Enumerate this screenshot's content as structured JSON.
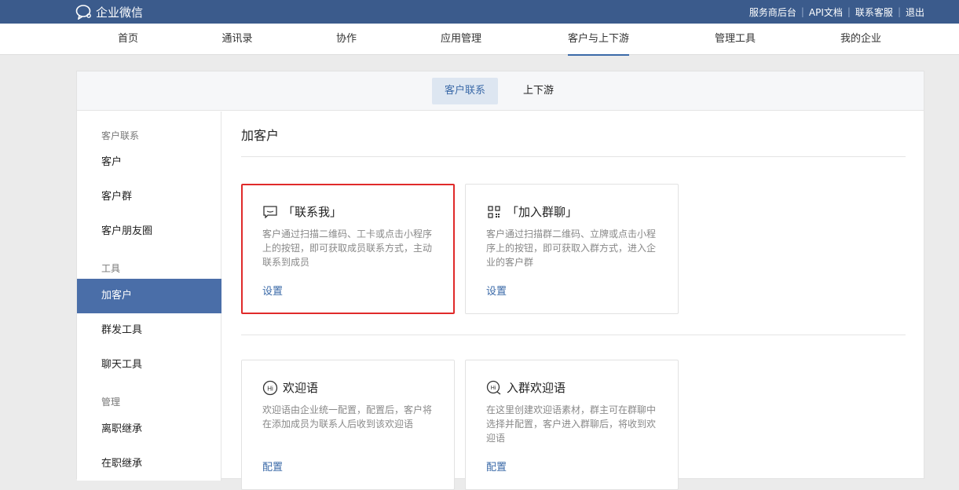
{
  "app": {
    "name": "企业微信"
  },
  "top_links": [
    "服务商后台",
    "API文档",
    "联系客服",
    "退出"
  ],
  "main_nav": {
    "items": [
      "首页",
      "通讯录",
      "协作",
      "应用管理",
      "客户与上下游",
      "管理工具",
      "我的企业"
    ],
    "active": "客户与上下游"
  },
  "sub_tabs": {
    "items": [
      "客户联系",
      "上下游"
    ],
    "active": "客户联系"
  },
  "sidebar": {
    "groups": [
      {
        "title": "客户联系",
        "items": [
          "客户",
          "客户群",
          "客户朋友圈"
        ]
      },
      {
        "title": "工具",
        "items": [
          "加客户",
          "群发工具",
          "聊天工具"
        ]
      },
      {
        "title": "管理",
        "items": [
          "离职继承",
          "在职继承"
        ]
      }
    ],
    "active_item": "加客户"
  },
  "content": {
    "title": "加客户",
    "cards": [
      {
        "icon": "chat-bubble-icon",
        "title": "「联系我」",
        "desc": "客户通过扫描二维码、工卡或点击小程序上的按钮，即可获取成员联系方式，主动联系到成员",
        "link": "设置",
        "highlighted": true
      },
      {
        "icon": "qr-code-icon",
        "title": "「加入群聊」",
        "desc": "客户通过扫描群二维码、立牌或点击小程序上的按钮，即可获取入群方式，进入企业的客户群",
        "link": "设置",
        "highlighted": false
      },
      {
        "icon": "hi-greeting-icon",
        "title": "欢迎语",
        "desc": "欢迎语由企业统一配置，配置后，客户将在添加成员为联系人后收到该欢迎语",
        "link": "配置",
        "highlighted": false
      },
      {
        "icon": "group-hi-greeting-icon",
        "title": "入群欢迎语",
        "desc": "在这里创建欢迎语素材，群主可在群聊中选择并配置，客户进入群聊后，将收到欢迎语",
        "link": "配置",
        "highlighted": false
      }
    ]
  },
  "colors": {
    "topbar": "#3b5b8c",
    "accent": "#3b6aa8",
    "sidebar_active": "#4a6ea8",
    "highlight_border": "#e02a2a"
  }
}
